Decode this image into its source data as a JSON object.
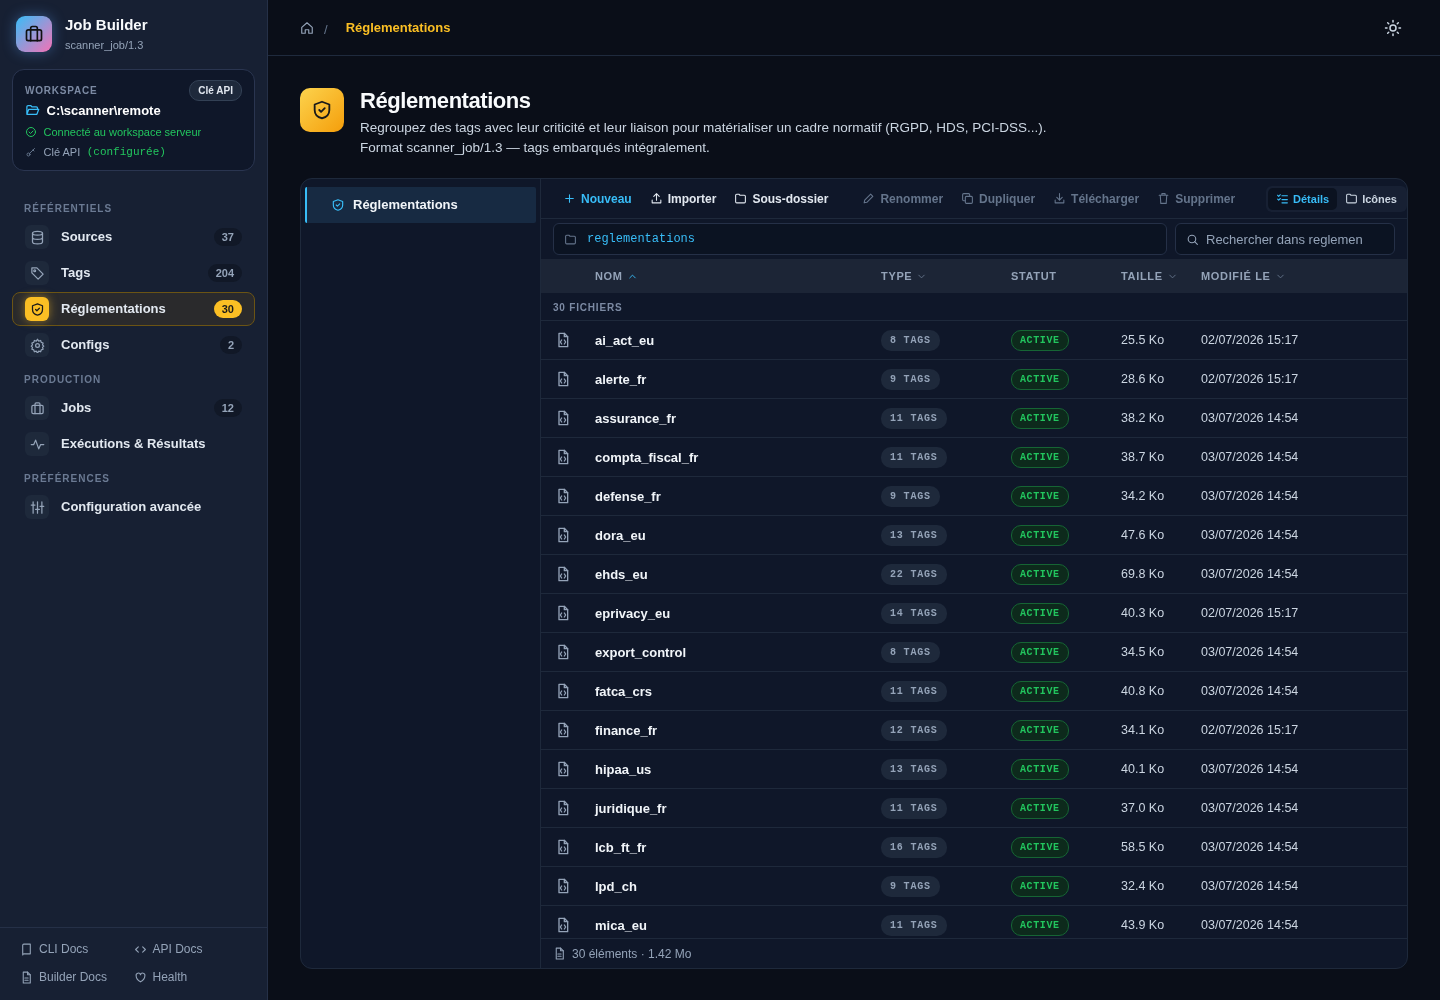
{
  "app": {
    "title": "Job Builder",
    "subtitle": "scanner_job/1.3"
  },
  "workspace": {
    "label": "WORKSPACE",
    "badge": "Clé API",
    "path": "C:\\scanner\\remote",
    "status": "Connecté au workspace serveur",
    "key_label": "Clé API",
    "key_state": "(configurée)"
  },
  "nav_sections": [
    {
      "title": "RÉFÉRENTIELS",
      "items": [
        {
          "label": "Sources",
          "count": "37",
          "selected": false
        },
        {
          "label": "Tags",
          "count": "204",
          "selected": false
        },
        {
          "label": "Réglementations",
          "count": "30",
          "selected": true
        },
        {
          "label": "Configs",
          "count": "2",
          "selected": false
        }
      ]
    },
    {
      "title": "PRODUCTION",
      "items": [
        {
          "label": "Jobs",
          "count": "12",
          "selected": false
        },
        {
          "label": "Exécutions & Résultats",
          "selected": false
        }
      ]
    },
    {
      "title": "PRÉFÉRENCES",
      "items": [
        {
          "label": "Configuration avancée",
          "selected": false
        }
      ]
    }
  ],
  "footer_links": [
    {
      "label": "CLI Docs"
    },
    {
      "label": "API Docs"
    },
    {
      "label": "Builder Docs"
    },
    {
      "label": "Health"
    }
  ],
  "breadcrumb": {
    "separator": "/",
    "current": "Réglementations"
  },
  "page": {
    "title": "Réglementations",
    "description": "Regroupez des tags avec leur criticité et leur liaison pour matérialiser un cadre normatif (RGPD, HDS, PCI-DSS...).",
    "note": "Format scanner_job/1.3 — tags embarqués intégralement."
  },
  "tree": [
    {
      "label": "Réglementations",
      "selected": true
    }
  ],
  "toolbar": [
    {
      "label": "Nouveau",
      "kind": "primary",
      "disabled": false
    },
    {
      "label": "Importer",
      "kind": "normal",
      "disabled": false
    },
    {
      "label": "Sous-dossier",
      "kind": "normal",
      "disabled": false
    },
    {
      "label": "Renommer",
      "kind": "normal",
      "disabled": true
    },
    {
      "label": "Dupliquer",
      "kind": "normal",
      "disabled": true
    },
    {
      "label": "Télécharger",
      "kind": "normal",
      "disabled": true
    },
    {
      "label": "Supprimer",
      "kind": "normal",
      "disabled": true
    }
  ],
  "views": [
    {
      "label": "Détails",
      "selected": true
    },
    {
      "label": "Icônes",
      "selected": false
    }
  ],
  "path_field": {
    "value": "reglementations"
  },
  "search": {
    "placeholder": "Rechercher dans reglemen"
  },
  "table": {
    "columns": [
      {
        "label": "NOM",
        "kind": "sorted"
      },
      {
        "label": "TYPE",
        "kind": "sortable"
      },
      {
        "label": "STATUT",
        "kind": "plain"
      },
      {
        "label": "TAILLE",
        "kind": "sortable"
      },
      {
        "label": "MODIFIÉ LE",
        "kind": "sortable"
      }
    ],
    "group": "30 FICHIERS",
    "rows": [
      {
        "name": "ai_act_eu",
        "type": "8 TAGS",
        "status": "ACTIVE",
        "size": "25.5 Ko",
        "modified": "02/07/2026 15:17"
      },
      {
        "name": "alerte_fr",
        "type": "9 TAGS",
        "status": "ACTIVE",
        "size": "28.6 Ko",
        "modified": "02/07/2026 15:17"
      },
      {
        "name": "assurance_fr",
        "type": "11 TAGS",
        "status": "ACTIVE",
        "size": "38.2 Ko",
        "modified": "03/07/2026 14:54"
      },
      {
        "name": "compta_fiscal_fr",
        "type": "11 TAGS",
        "status": "ACTIVE",
        "size": "38.7 Ko",
        "modified": "03/07/2026 14:54"
      },
      {
        "name": "defense_fr",
        "type": "9 TAGS",
        "status": "ACTIVE",
        "size": "34.2 Ko",
        "modified": "03/07/2026 14:54"
      },
      {
        "name": "dora_eu",
        "type": "13 TAGS",
        "status": "ACTIVE",
        "size": "47.6 Ko",
        "modified": "03/07/2026 14:54"
      },
      {
        "name": "ehds_eu",
        "type": "22 TAGS",
        "status": "ACTIVE",
        "size": "69.8 Ko",
        "modified": "03/07/2026 14:54"
      },
      {
        "name": "eprivacy_eu",
        "type": "14 TAGS",
        "status": "ACTIVE",
        "size": "40.3 Ko",
        "modified": "02/07/2026 15:17"
      },
      {
        "name": "export_control",
        "type": "8 TAGS",
        "status": "ACTIVE",
        "size": "34.5 Ko",
        "modified": "03/07/2026 14:54"
      },
      {
        "name": "fatca_crs",
        "type": "11 TAGS",
        "status": "ACTIVE",
        "size": "40.8 Ko",
        "modified": "03/07/2026 14:54"
      },
      {
        "name": "finance_fr",
        "type": "12 TAGS",
        "status": "ACTIVE",
        "size": "34.1 Ko",
        "modified": "02/07/2026 15:17"
      },
      {
        "name": "hipaa_us",
        "type": "13 TAGS",
        "status": "ACTIVE",
        "size": "40.1 Ko",
        "modified": "03/07/2026 14:54"
      },
      {
        "name": "juridique_fr",
        "type": "11 TAGS",
        "status": "ACTIVE",
        "size": "37.0 Ko",
        "modified": "03/07/2026 14:54"
      },
      {
        "name": "lcb_ft_fr",
        "type": "16 TAGS",
        "status": "ACTIVE",
        "size": "58.5 Ko",
        "modified": "03/07/2026 14:54"
      },
      {
        "name": "lpd_ch",
        "type": "9 TAGS",
        "status": "ACTIVE",
        "size": "32.4 Ko",
        "modified": "03/07/2026 14:54"
      },
      {
        "name": "mica_eu",
        "type": "11 TAGS",
        "status": "ACTIVE",
        "size": "43.9 Ko",
        "modified": "03/07/2026 14:54"
      }
    ]
  },
  "status_bar": "30 éléments · 1.42 Mo"
}
